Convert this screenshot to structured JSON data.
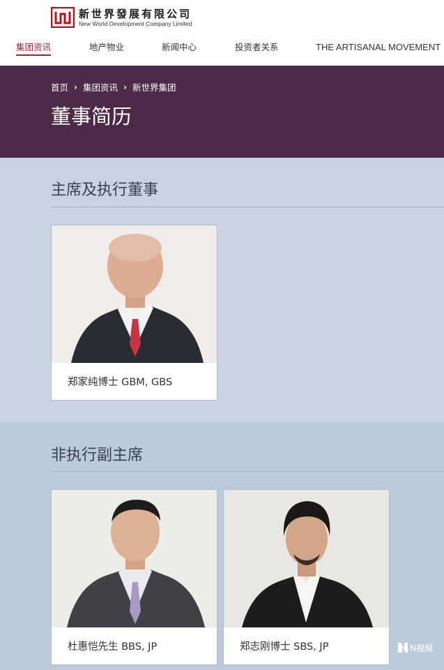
{
  "brand": {
    "name_cn": "新世界發展有限公司",
    "name_en": "New World Development Company Limited"
  },
  "nav": [
    {
      "label": "集团资讯",
      "active": true
    },
    {
      "label": "地产物业",
      "active": false
    },
    {
      "label": "新闻中心",
      "active": false
    },
    {
      "label": "投资者关系",
      "active": false
    },
    {
      "label": "THE ARTISANAL MOVEMENT",
      "active": false
    }
  ],
  "breadcrumb": [
    "首页",
    "集团资讯",
    "新世界集团"
  ],
  "page_title": "董事简历",
  "sections": [
    {
      "title": "主席及执行董事",
      "cards": [
        {
          "name": "郑家纯博士 GBM, GBS"
        }
      ]
    },
    {
      "title": "非执行副主席",
      "cards": [
        {
          "name": "杜惠恺先生 BBS, JP"
        },
        {
          "name": "郑志刚博士 SBS, JP"
        }
      ]
    }
  ],
  "watermark": {
    "text": "N视频"
  },
  "colors": {
    "accent": "#a41c3a",
    "banner": "#4c2a48",
    "background": "#c5d1df"
  }
}
